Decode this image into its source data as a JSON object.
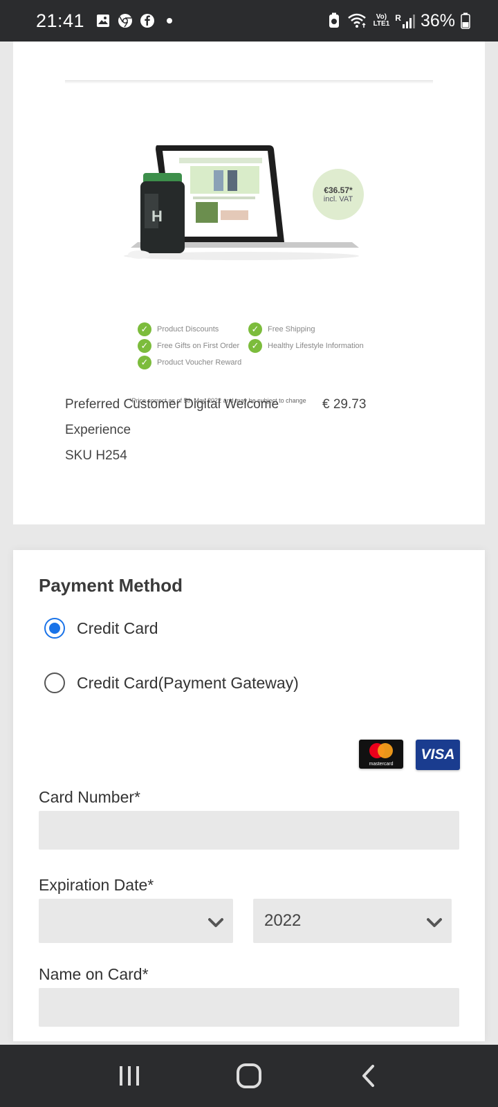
{
  "status_bar": {
    "time": "21:41",
    "network_top": "Vo)",
    "network_bottom": "LTE1",
    "sim_label": "R",
    "battery": "36%"
  },
  "product": {
    "promo_price": "€36.57*",
    "promo_vat": "incl. VAT",
    "benefits": [
      "Product Discounts",
      "Free Shipping",
      "Free Gifts on First Order",
      "Healthy Lifestyle Information",
      "Product Voucher Reward"
    ],
    "disclaimer": "*Price correct as of 5th May 2022 and may be subject to change",
    "name": "Preferred Customer Digital Welcome Experience",
    "sku": "SKU H254",
    "price": "€ 29.73"
  },
  "payment": {
    "title": "Payment Method",
    "options": [
      {
        "label": "Credit Card",
        "selected": true
      },
      {
        "label": "Credit Card(Payment Gateway)",
        "selected": false
      }
    ],
    "mastercard_text": "mastercard",
    "visa_text": "VISA",
    "card_number_label": "Card Number*",
    "card_number_value": "",
    "expiration_label": "Expiration Date*",
    "expiration_month": "",
    "expiration_year": "2022",
    "name_label": "Name on Card*",
    "name_value": ""
  },
  "colors": {
    "accent": "#1a73e8",
    "check_green": "#7cbc3c",
    "visa_blue": "#1a3c8f"
  }
}
